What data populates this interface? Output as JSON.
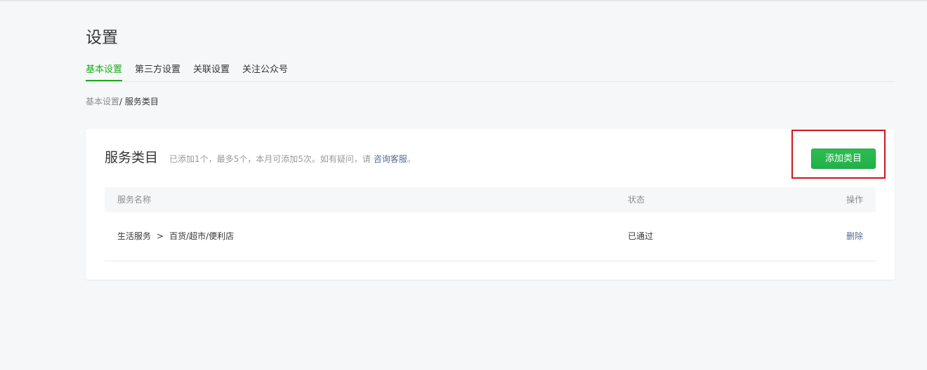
{
  "page": {
    "title": "设置"
  },
  "tabs": [
    {
      "label": "基本设置",
      "active": true
    },
    {
      "label": "第三方设置",
      "active": false
    },
    {
      "label": "关联设置",
      "active": false
    },
    {
      "label": "关注公众号",
      "active": false
    }
  ],
  "breadcrumb": {
    "parent": "基本设置",
    "separator": "/ ",
    "current": "服务类目"
  },
  "card": {
    "title": "服务类目",
    "desc_prefix": "已添加1个，最多5个，本月可添加5次。如有疑问，请 ",
    "desc_link": "咨询客服",
    "desc_suffix": "。",
    "add_button": "添加类目"
  },
  "table": {
    "headers": {
      "name": "服务名称",
      "status": "状态",
      "op": "操作"
    },
    "rows": [
      {
        "category": "生活服务",
        "arrow": ">",
        "subcategory": "百货/超市/便利店",
        "status": "已通过",
        "op": "删除"
      }
    ]
  },
  "colors": {
    "accent": "#1aad19",
    "link": "#576b95",
    "highlight": "#d0141c"
  }
}
